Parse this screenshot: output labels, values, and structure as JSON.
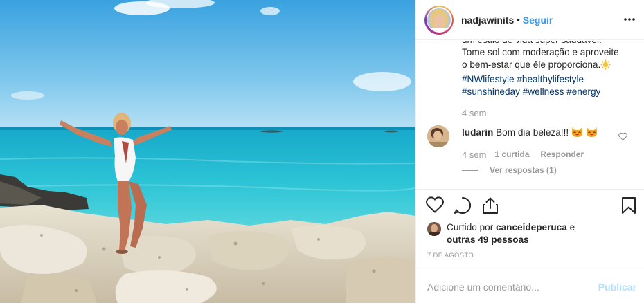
{
  "post": {
    "username": "nadjawinits",
    "separator": "•",
    "follow_label": "Seguir",
    "more_icon": "more-options-icon"
  },
  "caption": {
    "line_top": "um estilo de vida super saudável.",
    "line1": "Tome sol com moderação e aproveite",
    "line2": "o bem-estar que êle proporciona.",
    "hashtags": [
      "#NWlifestyle",
      "#healthylifestyle",
      "#sunshineday",
      "#wellness",
      "#energy"
    ],
    "time": "4 sem"
  },
  "comment": {
    "username": "ludarin",
    "text": "Bom dia beleza!!!",
    "time": "4 sem",
    "likes": "1 curtida",
    "reply_label": "Responder",
    "view_replies": "Ver respostas (1)"
  },
  "likes": {
    "prefix": "Curtido por",
    "user": "canceideperuca",
    "connector": "e",
    "others": "outras 49 pessoas"
  },
  "date": "7 DE AGOSTO",
  "add_comment": {
    "placeholder": "Adicione um comentário...",
    "publish_label": "Publicar"
  },
  "colors": {
    "accent": "#3897f0",
    "hashtag": "#003569",
    "muted": "#999999",
    "publish_disabled": "#b2dffc"
  }
}
